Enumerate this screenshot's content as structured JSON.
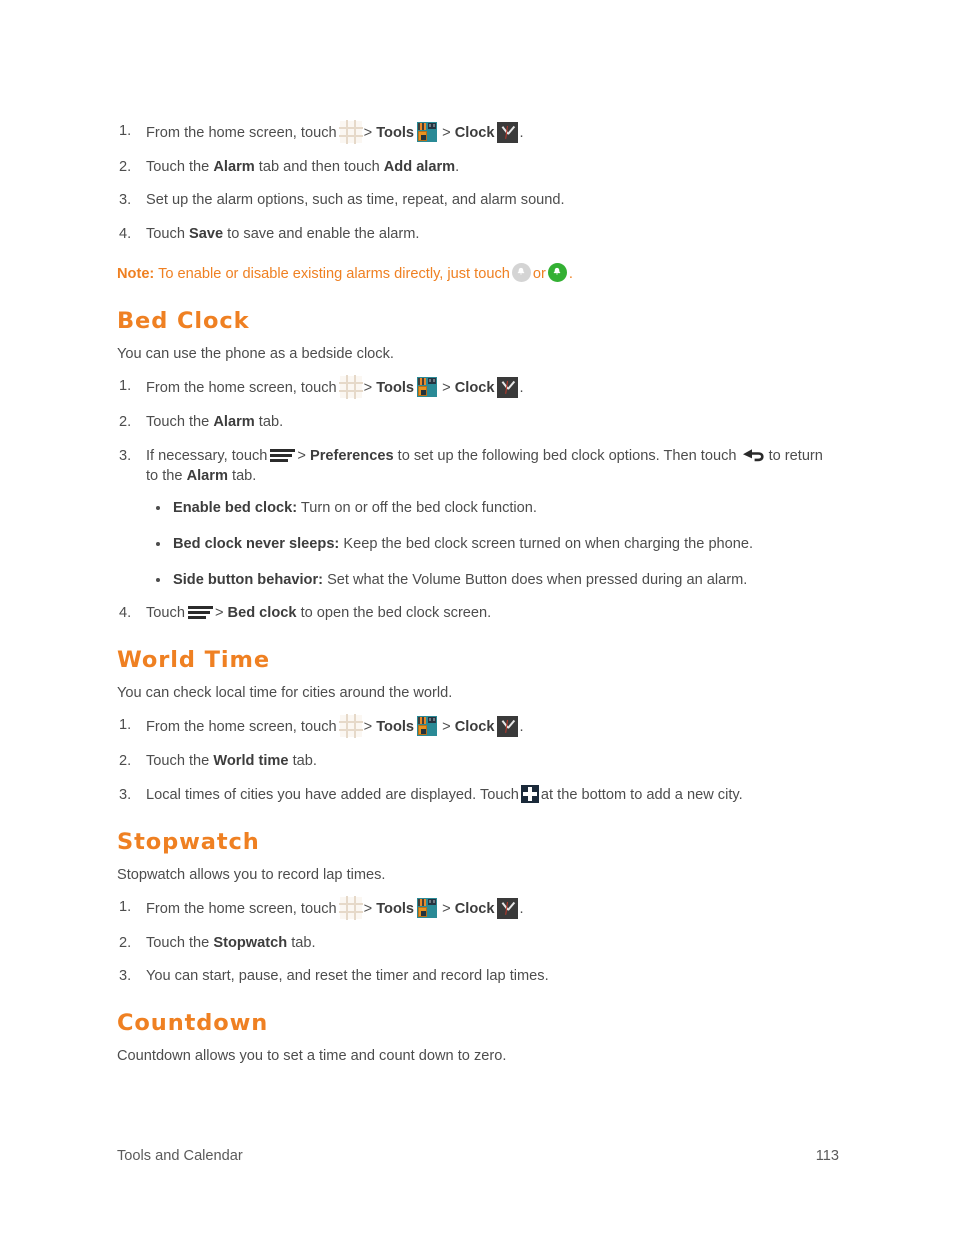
{
  "document": {
    "footer": {
      "chapter": "Tools and Calendar",
      "page_number": "113"
    }
  },
  "alarm_steps": {
    "step1_a": "From the home screen, touch",
    "step1_sep1": ">",
    "step1_tools": "Tools",
    "step1_sep2": ">",
    "step1_clock": "Clock",
    "step1_end": ".",
    "step2_a": "Touch the",
    "step2_alarm": "Alarm",
    "step2_b": "tab and then touch",
    "step2_add": "Add alarm",
    "step2_end": ".",
    "step3": "Set up the alarm options, such as time, repeat, and alarm sound.",
    "step4_a": "Touch",
    "step4_save": "Save",
    "step4_b": "to save and enable the alarm."
  },
  "note": {
    "label": "Note:",
    "text_a": "To enable or disable existing alarms directly, just touch",
    "text_or": "or",
    "text_end": "."
  },
  "bed_clock": {
    "heading": "Bed Clock",
    "intro": "You can use the phone as a bedside clock.",
    "step1_a": "From the home screen, touch",
    "step1_sep1": ">",
    "step1_tools": "Tools",
    "step1_sep2": ">",
    "step1_clock": "Clock",
    "step1_end": ".",
    "step2_a": "Touch the",
    "step2_alarm": "Alarm",
    "step2_b": "tab.",
    "step3_a": "If necessary, touch",
    "step3_sep": ">",
    "step3_prefs": "Preferences",
    "step3_b": "to set up the following bed clock options. Then touch",
    "step3_c": "to return to the",
    "step3_alarm": "Alarm",
    "step3_d": "tab.",
    "bullets": [
      {
        "label": "Enable bed clock:",
        "text": "Turn on or off the bed clock function."
      },
      {
        "label": "Bed clock never sleeps:",
        "text": "Keep the bed clock screen turned on when charging the phone."
      },
      {
        "label": "Side button behavior:",
        "text": "Set what the Volume Button does when pressed during an alarm."
      }
    ],
    "step4_a": "Touch",
    "step4_sep": ">",
    "step4_bedclock": "Bed clock",
    "step4_b": "to open the bed clock screen."
  },
  "world_time": {
    "heading": "World Time",
    "intro": "You can check local time for cities around the world.",
    "step1_a": "From the home screen, touch",
    "step1_sep1": ">",
    "step1_tools": "Tools",
    "step1_sep2": ">",
    "step1_clock": "Clock",
    "step1_end": ".",
    "step2_a": "Touch the",
    "step2_tab": "World time",
    "step2_b": "tab.",
    "step3_a": "Local times of cities you have added are displayed. Touch",
    "step3_b": "at the bottom to add a new city."
  },
  "stopwatch": {
    "heading": "Stopwatch",
    "intro": "Stopwatch allows you to record lap times.",
    "step1_a": "From the home screen, touch",
    "step1_sep1": ">",
    "step1_tools": "Tools",
    "step1_sep2": ">",
    "step1_clock": "Clock",
    "step1_end": ".",
    "step2_a": "Touch the",
    "step2_tab": "Stopwatch",
    "step2_b": "tab.",
    "step3": "You can start, pause, and reset the timer and record lap times."
  },
  "countdown": {
    "heading": "Countdown",
    "intro": "Countdown allows you to set a time and count down to zero."
  },
  "icons": {
    "apps": "apps-grid-icon",
    "tools": "tools-app-icon",
    "clock": "clock-app-icon",
    "bell_off": "bell-disabled-icon",
    "bell_on": "bell-enabled-icon",
    "menu": "hamburger-menu-icon",
    "back": "back-arrow-icon",
    "plus": "add-plus-icon"
  },
  "colors": {
    "heading_orange": "#ef8022",
    "note_orange": "#ef8022",
    "body_gray": "#4d4d4d",
    "tools_teal": "#2a8a96",
    "bell_green": "#33b033",
    "plus_navy": "#1b2a3a"
  }
}
